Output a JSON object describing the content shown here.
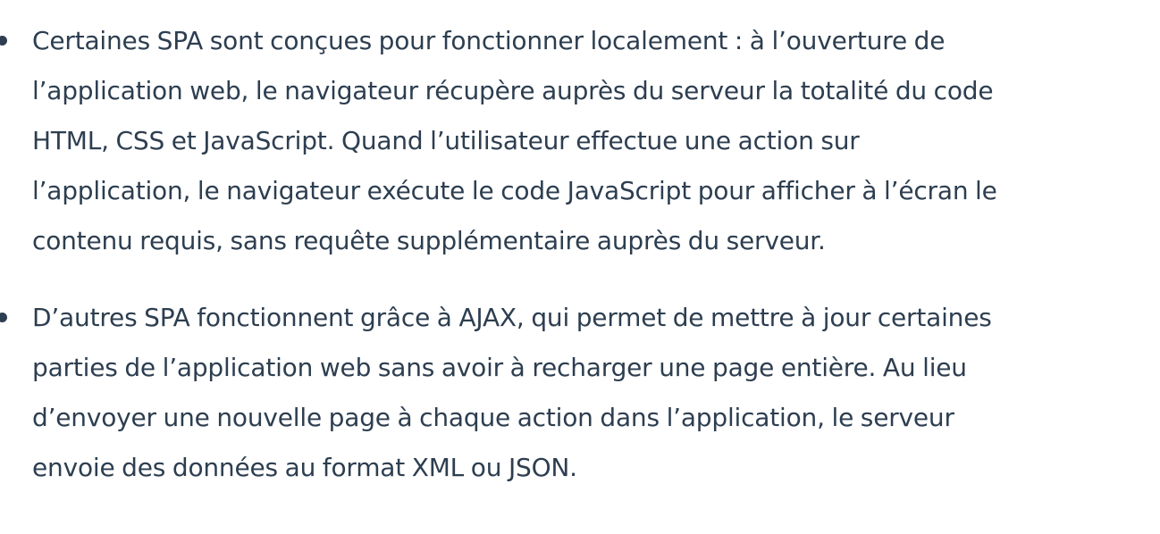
{
  "bullets": [
    {
      "lines": [
        "Certaines SPA sont conçues pour fonctionner localement : à l’ouverture de",
        "l’application web, le navigateur récupère auprès du serveur la totalité du code",
        "HTML, CSS et JavaScript. Quand l’utilisateur effectue une action sur",
        "l’application, le navigateur exécute le code JavaScript pour afficher à l’écran le",
        "contenu requis, sans requête supplémentaire auprès du serveur."
      ]
    },
    {
      "lines": [
        "D’autres SPA fonctionnent grâce à AJAX, qui permet de mettre à jour certaines",
        "parties de l’application web sans avoir à recharger une page entière. Au lieu",
        "d’envoyer une nouvelle page à chaque action dans l’application, le serveur",
        "envoie des données au format XML ou JSON."
      ]
    }
  ]
}
